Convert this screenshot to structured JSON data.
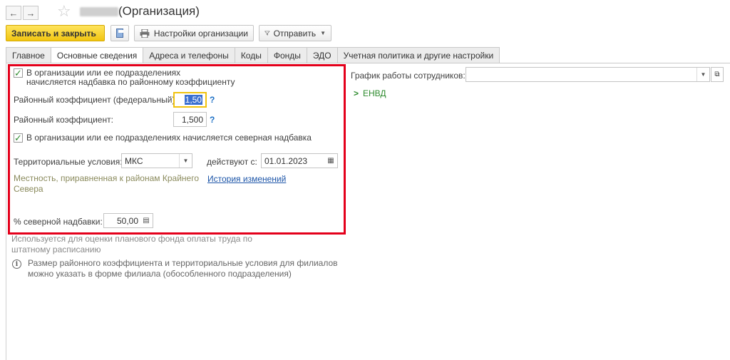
{
  "window": {
    "title": "(Организация)",
    "back_icon": "←",
    "forward_icon": "→",
    "star_icon": "☆"
  },
  "toolbar": {
    "save_close_label": "Записать и закрыть",
    "org_settings_label": "Настройки организации",
    "send_label": "Отправить"
  },
  "tabs": [
    {
      "label": "Главное"
    },
    {
      "label": "Основные сведения"
    },
    {
      "label": "Адреса и телефоны"
    },
    {
      "label": "Коды"
    },
    {
      "label": "Фонды"
    },
    {
      "label": "ЭДО"
    },
    {
      "label": "Учетная политика и другие настройки"
    }
  ],
  "form": {
    "district_check_label_line1": "В организации или ее подразделениях",
    "district_check_label_line2": "начисляется надбавка по районному коэффициенту",
    "district_federal_label": "Районный коэффициент (федеральный):",
    "district_federal_value": "1,50",
    "district_label": "Районный коэффициент:",
    "district_value": "1,500",
    "help_mark": "?",
    "north_check_label": "В организации или ее подразделениях начисляется северная надбавка",
    "territorial_label": "Территориальные условия:",
    "territorial_value": "МКС",
    "valid_from_label": "действуют с:",
    "valid_from_value": "01.01.2023",
    "territory_note_line1": "Местность, приравненная к районам Крайнего",
    "territory_note_line2": "Севера",
    "history_link": "История изменений",
    "north_percent_label": "% северной надбавки:",
    "north_percent_value": "50,00",
    "usage_note_line1": "Используется для оценки планового фонда оплаты труда по",
    "usage_note_line2": "штатному расписанию",
    "info_line1": "Размер районного коэффициента и территориальные условия для филиалов",
    "info_line2": "можно указать в форме филиала (обособленного подразделения)"
  },
  "right": {
    "schedule_label": "График работы сотрудников:",
    "schedule_value": "",
    "envd_label": "ЕНВД"
  },
  "colors": {
    "accent_yellow": "#f1c511",
    "frame_red": "#e4001b",
    "link_blue": "#1c55a8",
    "check_green": "#2e8b2e"
  }
}
